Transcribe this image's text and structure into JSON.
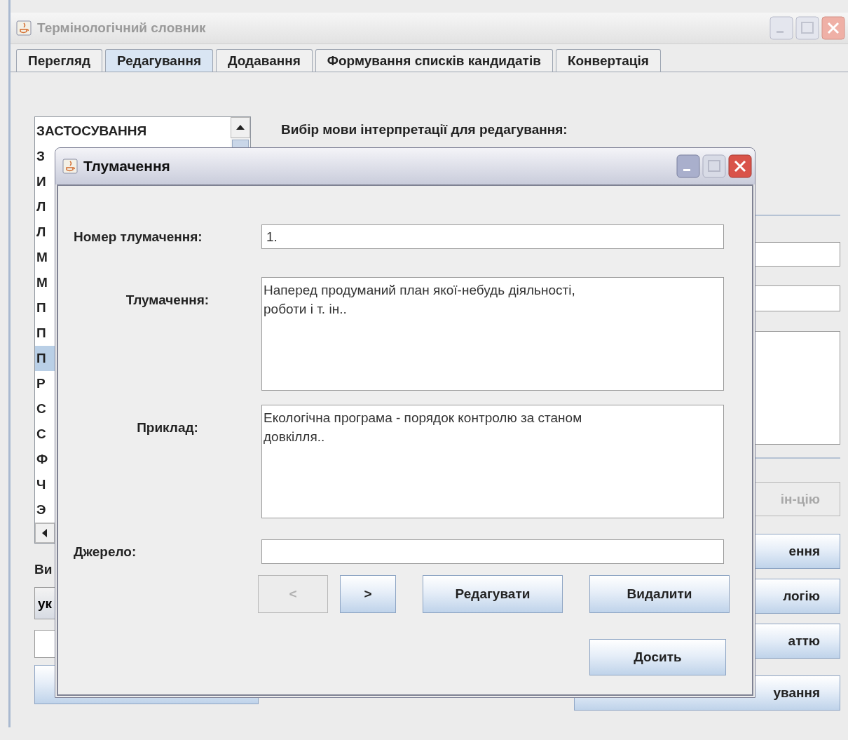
{
  "window": {
    "title": "Термінологічний словник"
  },
  "tabs": [
    {
      "label": "Перегляд",
      "selected": false
    },
    {
      "label": "Редагування",
      "selected": true
    },
    {
      "label": "Додавання",
      "selected": false
    },
    {
      "label": "Формування списків кандидатів",
      "selected": false
    },
    {
      "label": "Конвертація",
      "selected": false
    }
  ],
  "term_list": {
    "items": [
      {
        "label": "ЗАСТОСУВАННЯ",
        "selected": false
      },
      {
        "label": "З",
        "selected": false
      },
      {
        "label": "И",
        "selected": false
      },
      {
        "label": "Л",
        "selected": false
      },
      {
        "label": "Л",
        "selected": false
      },
      {
        "label": "М",
        "selected": false
      },
      {
        "label": "М",
        "selected": false
      },
      {
        "label": "П",
        "selected": false
      },
      {
        "label": "П",
        "selected": false
      },
      {
        "label": "П",
        "selected": true
      },
      {
        "label": "Р",
        "selected": false
      },
      {
        "label": "С",
        "selected": false
      },
      {
        "label": "С",
        "selected": false
      },
      {
        "label": "Ф",
        "selected": false
      },
      {
        "label": "Ч",
        "selected": false
      },
      {
        "label": "Э",
        "selected": false
      }
    ]
  },
  "language_label": "Ви",
  "language_combo": {
    "value": "ук"
  },
  "language_heading": "Вибір мови інтерпретації для редагування:",
  "right_buttons": [
    {
      "label": "ін-цію",
      "disabled": true
    },
    {
      "label": "ення",
      "disabled": false
    },
    {
      "label": "логію",
      "disabled": false
    },
    {
      "label": "аттю",
      "disabled": false
    },
    {
      "label": "ування",
      "disabled": false
    }
  ],
  "dialog": {
    "title": "Тлумачення",
    "fields": [
      {
        "kind": "line",
        "label": "Номер тлумачення:",
        "value": "1."
      },
      {
        "kind": "area",
        "label": "Тлумачення:",
        "value": "Наперед продуманий план якої-небудь діяльності,\nроботи і т. ін.."
      },
      {
        "kind": "area",
        "label": "Приклад:",
        "value": "Екологічна програма - порядок контролю за станом\nдовкілля.."
      },
      {
        "kind": "line",
        "label": "Джерело:"
      }
    ],
    "nav_buttons": [
      {
        "label": "<",
        "disabled": true
      },
      {
        "label": ">",
        "disabled": false
      }
    ],
    "buttons": [
      "Редагувати",
      "Видалити"
    ],
    "close_button": "Досить"
  }
}
